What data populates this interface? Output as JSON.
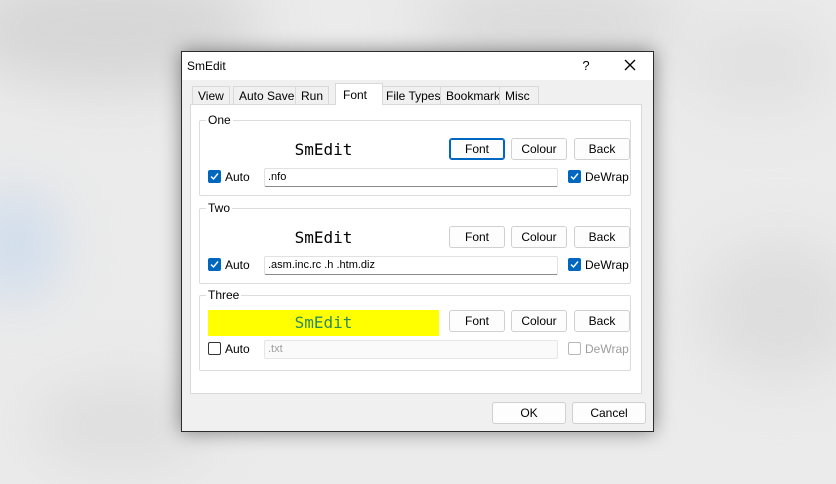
{
  "dialog": {
    "title": "SmEdit",
    "help_label": "?",
    "tabs": [
      {
        "label": "View",
        "active": false
      },
      {
        "label": "Auto Save",
        "active": false
      },
      {
        "label": "Run",
        "active": false
      },
      {
        "label": "Font",
        "active": true
      },
      {
        "label": "File Types",
        "active": false
      },
      {
        "label": "Bookmark",
        "active": false
      },
      {
        "label": "Misc",
        "active": false
      }
    ],
    "groups": [
      {
        "title": "One",
        "sample_text": "SmEdit",
        "sample_bg": "#ffffff",
        "sample_fg": "#000000",
        "font_label": "Font",
        "colour_label": "Colour",
        "back_label": "Back",
        "auto_label": "Auto",
        "auto_checked": true,
        "extensions": ".nfo",
        "dewrap_label": "DeWrap",
        "dewrap_checked": true,
        "enabled": true
      },
      {
        "title": "Two",
        "sample_text": "SmEdit",
        "sample_bg": "#ffffff",
        "sample_fg": "#000000",
        "font_label": "Font",
        "colour_label": "Colour",
        "back_label": "Back",
        "auto_label": "Auto",
        "auto_checked": true,
        "extensions": ".asm.inc.rc .h  .htm.diz",
        "dewrap_label": "DeWrap",
        "dewrap_checked": true,
        "enabled": true
      },
      {
        "title": "Three",
        "sample_text": "SmEdit",
        "sample_bg": "#ffff00",
        "sample_fg": "#2e8b57",
        "font_label": "Font",
        "colour_label": "Colour",
        "back_label": "Back",
        "auto_label": "Auto",
        "auto_checked": false,
        "extensions": ".txt",
        "dewrap_label": "DeWrap",
        "dewrap_checked": false,
        "enabled": false
      }
    ],
    "ok_label": "OK",
    "cancel_label": "Cancel"
  },
  "colors": {
    "accent": "#0067c0",
    "dialog_bg": "#f0f0f0",
    "panel_bg": "#ffffff"
  }
}
